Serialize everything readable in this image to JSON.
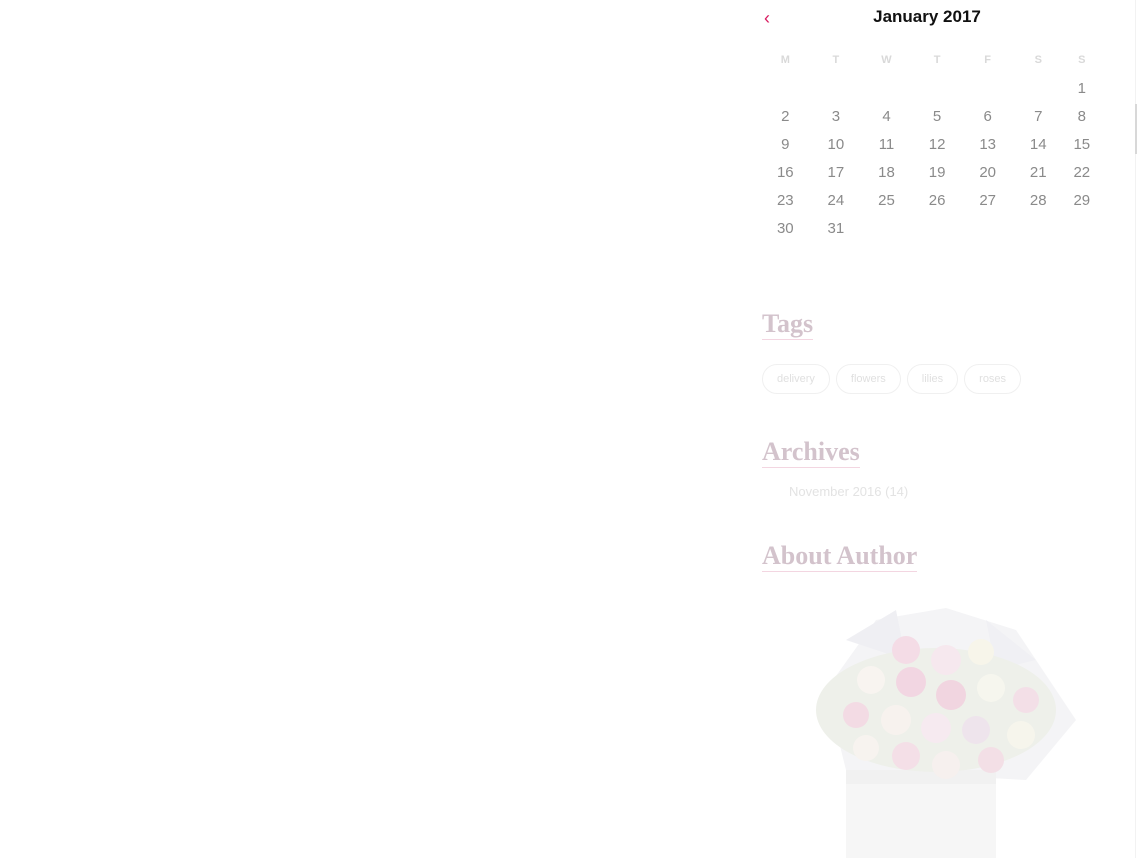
{
  "calendar": {
    "prev_icon": "chevron-left-icon",
    "prev_glyph": "‹",
    "title": "January 2017",
    "weekdays": [
      "M",
      "T",
      "W",
      "T",
      "F",
      "S",
      "S"
    ],
    "weeks": [
      [
        "",
        "",
        "",
        "",
        "",
        "",
        "1"
      ],
      [
        "2",
        "3",
        "4",
        "5",
        "6",
        "7",
        "8"
      ],
      [
        "9",
        "10",
        "11",
        "12",
        "13",
        "14",
        "15"
      ],
      [
        "16",
        "17",
        "18",
        "19",
        "20",
        "21",
        "22"
      ],
      [
        "23",
        "24",
        "25",
        "26",
        "27",
        "28",
        "29"
      ],
      [
        "30",
        "31",
        "",
        "",
        "",
        "",
        ""
      ]
    ]
  },
  "tags": {
    "title": "Tags",
    "items": [
      "delivery",
      "flowers",
      "lilies",
      "roses"
    ]
  },
  "archives": {
    "title": "Archives",
    "items": [
      {
        "label": "November 2016",
        "count": "(14)"
      }
    ]
  },
  "about": {
    "title": "About Author",
    "image_icon": "flower-bouquet-image"
  },
  "colors": {
    "accent": "#d81b60",
    "title_faded": "#d3c3cc"
  }
}
